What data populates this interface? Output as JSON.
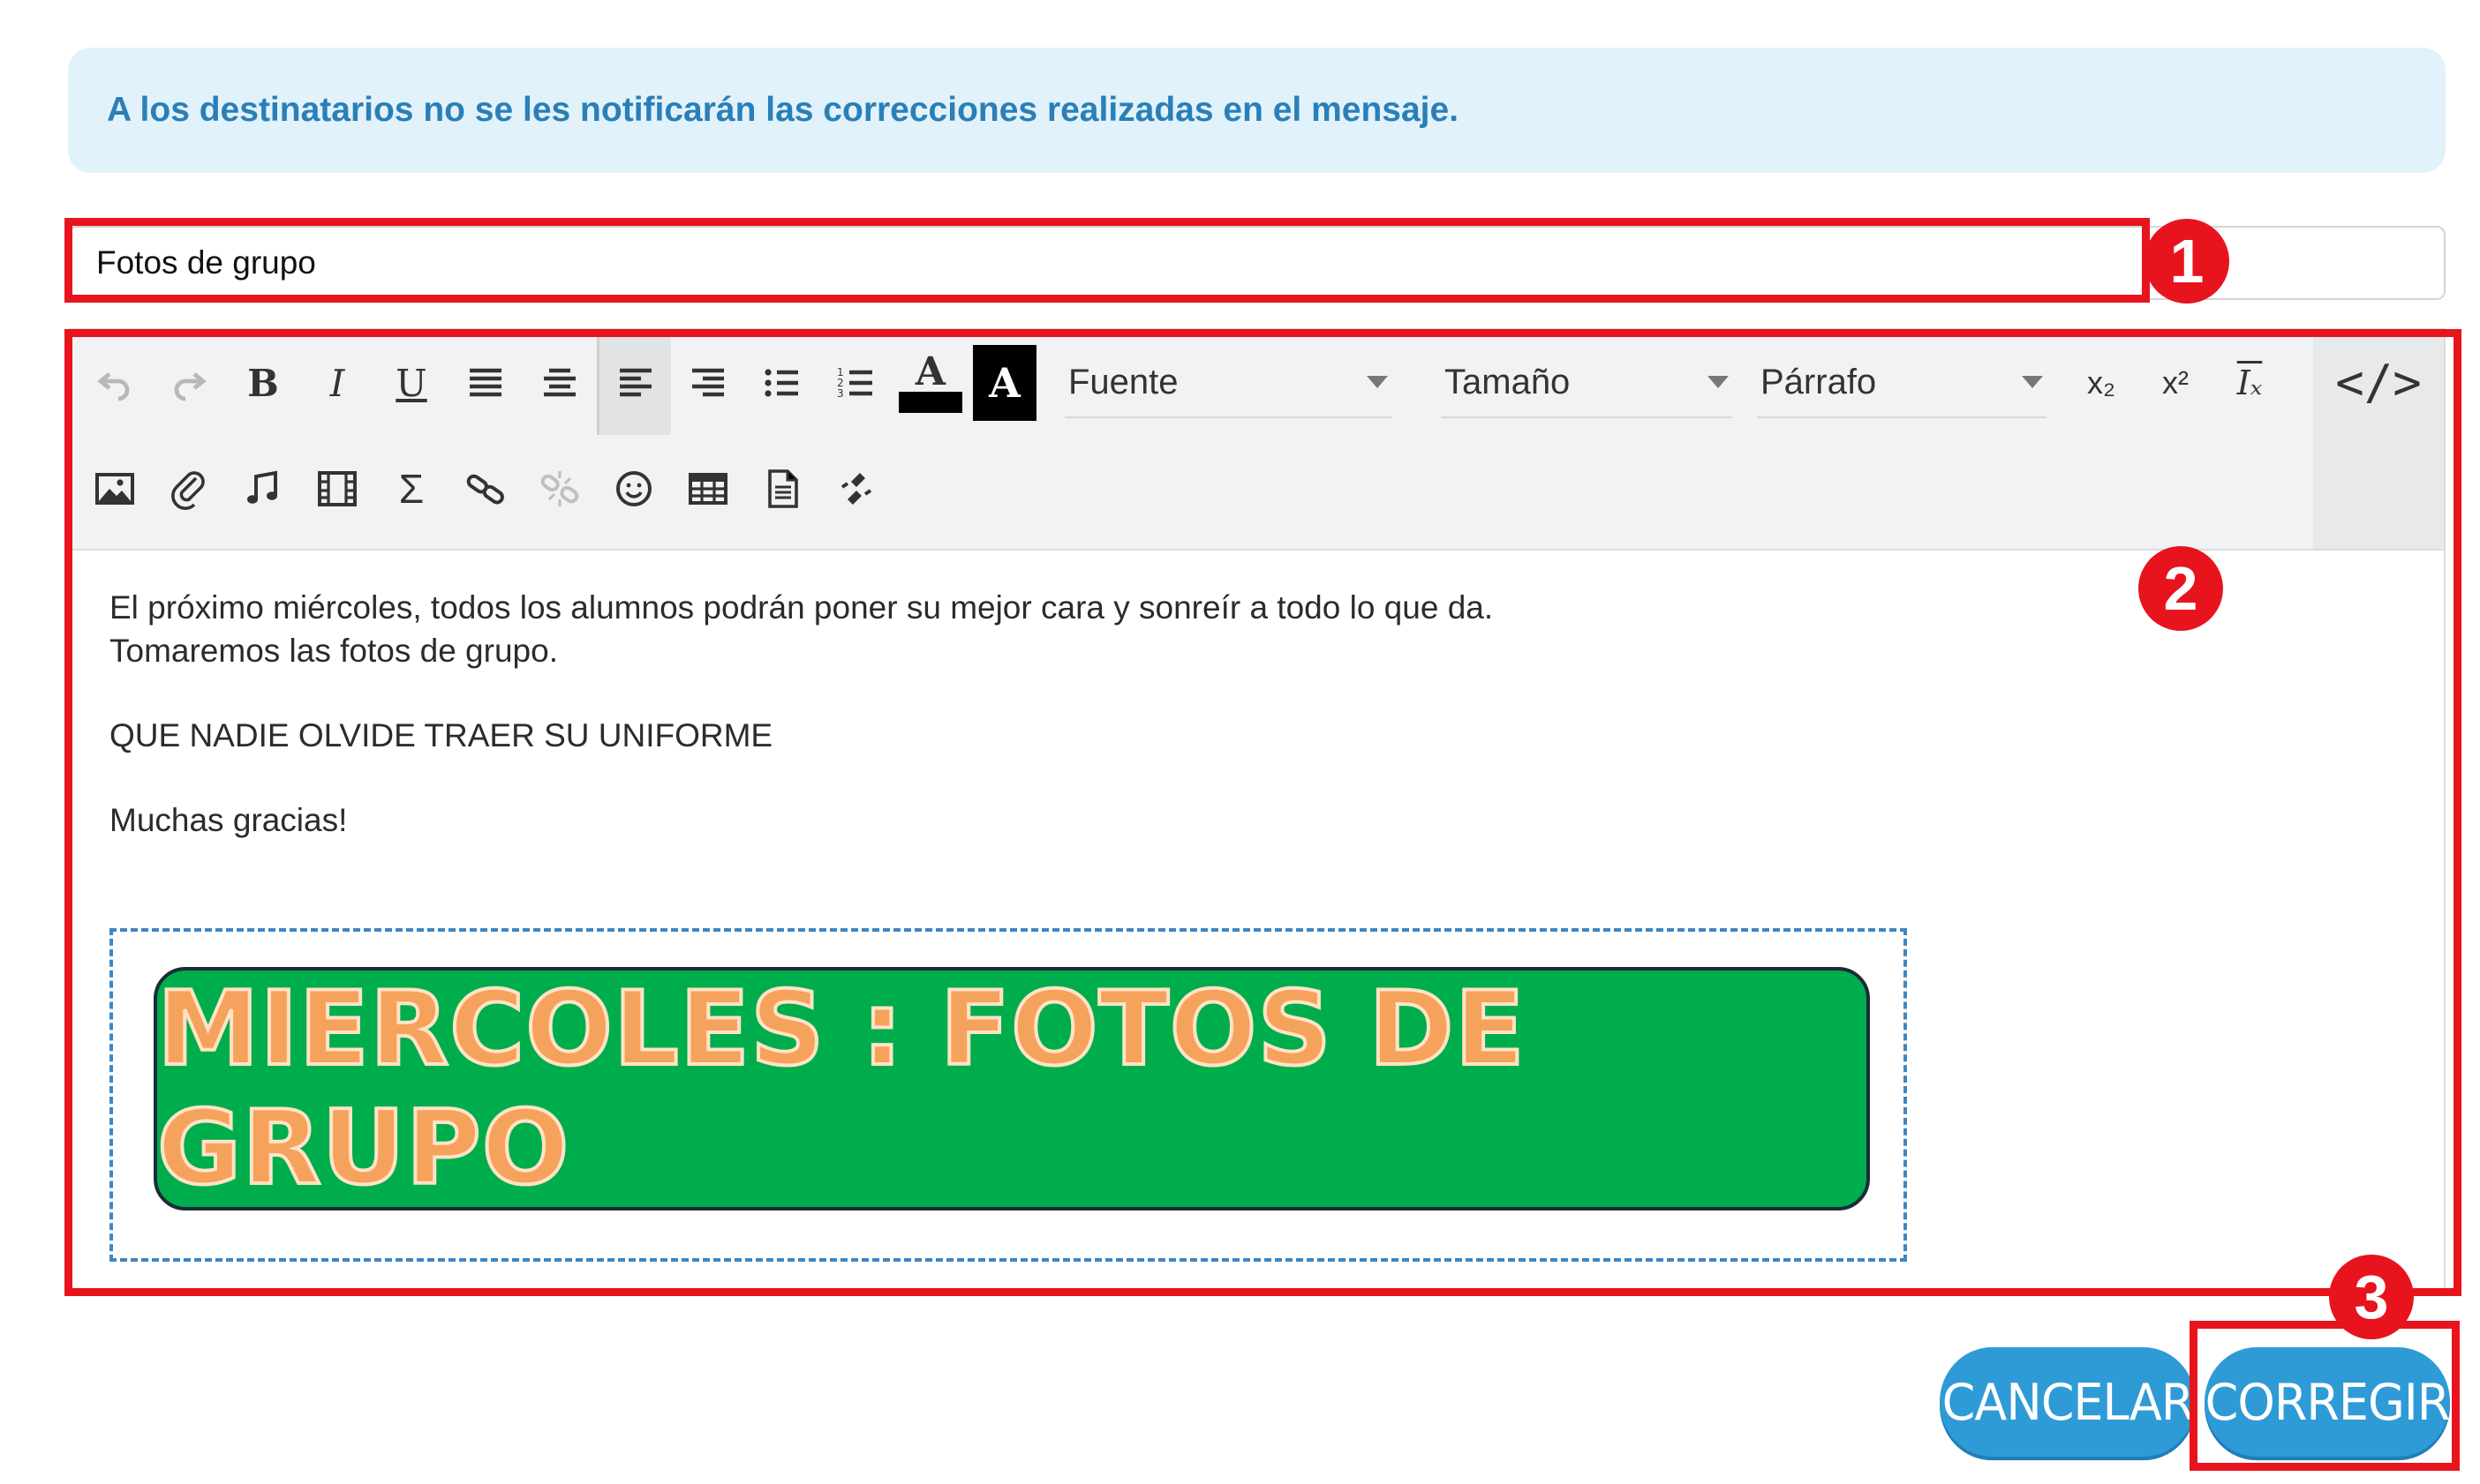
{
  "notice": {
    "text": "A los destinatarios no se les notificarán las correcciones realizadas en el mensaje."
  },
  "subject": {
    "value": "Fotos de grupo"
  },
  "toolbar": {
    "row1": [
      {
        "name": "undo-icon",
        "glyph": "↶",
        "state": "disabled"
      },
      {
        "name": "redo-icon",
        "glyph": "↷",
        "state": "disabled"
      },
      {
        "name": "bold-icon",
        "glyph": "B"
      },
      {
        "name": "italic-icon",
        "glyph": "I"
      },
      {
        "name": "underline-icon",
        "glyph": "U"
      },
      {
        "name": "align-justify-icon",
        "glyph": "≣"
      },
      {
        "name": "align-center-icon",
        "glyph": "≡"
      },
      {
        "name": "align-left-icon",
        "glyph": "≡",
        "state": "active"
      },
      {
        "name": "align-right-icon",
        "glyph": "≡"
      },
      {
        "name": "bullet-list-icon",
        "glyph": "☰"
      },
      {
        "name": "numbered-list-icon",
        "glyph": "☷"
      },
      {
        "name": "text-color-icon",
        "glyph": "A"
      },
      {
        "name": "background-color-icon",
        "glyph": "A"
      }
    ],
    "font_label": "Fuente",
    "size_label": "Tamaño",
    "paragraph_label": "Párrafo",
    "subscript_glyph": "x₂",
    "superscript_glyph": "x²",
    "clear_format_glyph": "Iₓ",
    "source_glyph": "</>",
    "row2": [
      {
        "name": "image-icon",
        "glyph": "🖼"
      },
      {
        "name": "attachment-icon",
        "glyph": "📎"
      },
      {
        "name": "audio-icon",
        "glyph": "♫"
      },
      {
        "name": "video-icon",
        "glyph": "🎞"
      },
      {
        "name": "formula-icon",
        "glyph": "Σ"
      },
      {
        "name": "link-icon",
        "glyph": "🔗"
      },
      {
        "name": "unlink-icon",
        "glyph": "⛓",
        "state": "disabled"
      },
      {
        "name": "emoji-icon",
        "glyph": "☺"
      },
      {
        "name": "table-icon",
        "glyph": "▦"
      },
      {
        "name": "template-icon",
        "glyph": "🗎"
      },
      {
        "name": "special-chars-icon",
        "glyph": "§"
      }
    ]
  },
  "message": {
    "line1": "El próximo miércoles, todos los alumnos podrán poner su mejor cara y sonreír a todo lo que da.",
    "line2": "Tomaremos las fotos de grupo.",
    "line3": "QUE NADIE OLVIDE TRAER SU UNIFORME",
    "line4": "Muchas gracias!",
    "banner_text": "MIERCOLES : FOTOS DE GRUPO"
  },
  "buttons": {
    "cancel": "CANCELAR",
    "correct": "CORREGIR"
  },
  "markers": {
    "m1": "1",
    "m2": "2",
    "m3": "3"
  },
  "colors": {
    "accent": "#2f9bd6",
    "highlight": "#e8141d",
    "banner_bg": "#00ad4d",
    "banner_text": "#f5a25c"
  }
}
